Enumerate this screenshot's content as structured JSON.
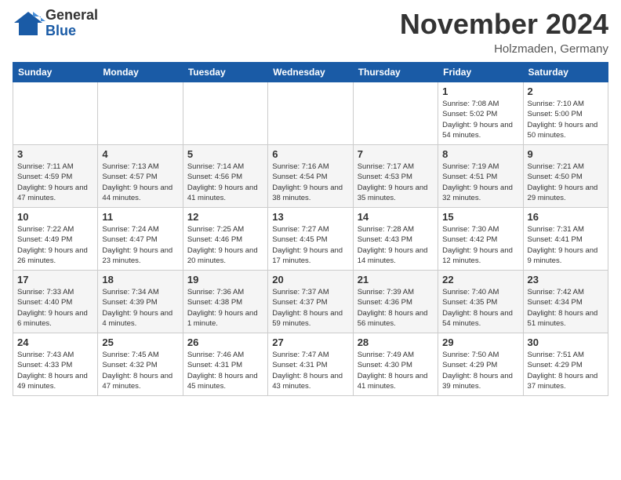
{
  "header": {
    "logo": {
      "general": "General",
      "blue": "Blue"
    },
    "title": "November 2024",
    "location": "Holzmaden, Germany"
  },
  "weekdays": [
    "Sunday",
    "Monday",
    "Tuesday",
    "Wednesday",
    "Thursday",
    "Friday",
    "Saturday"
  ],
  "weeks": [
    [
      {
        "day": "",
        "info": ""
      },
      {
        "day": "",
        "info": ""
      },
      {
        "day": "",
        "info": ""
      },
      {
        "day": "",
        "info": ""
      },
      {
        "day": "",
        "info": ""
      },
      {
        "day": "1",
        "info": "Sunrise: 7:08 AM\nSunset: 5:02 PM\nDaylight: 9 hours and 54 minutes."
      },
      {
        "day": "2",
        "info": "Sunrise: 7:10 AM\nSunset: 5:00 PM\nDaylight: 9 hours and 50 minutes."
      }
    ],
    [
      {
        "day": "3",
        "info": "Sunrise: 7:11 AM\nSunset: 4:59 PM\nDaylight: 9 hours and 47 minutes."
      },
      {
        "day": "4",
        "info": "Sunrise: 7:13 AM\nSunset: 4:57 PM\nDaylight: 9 hours and 44 minutes."
      },
      {
        "day": "5",
        "info": "Sunrise: 7:14 AM\nSunset: 4:56 PM\nDaylight: 9 hours and 41 minutes."
      },
      {
        "day": "6",
        "info": "Sunrise: 7:16 AM\nSunset: 4:54 PM\nDaylight: 9 hours and 38 minutes."
      },
      {
        "day": "7",
        "info": "Sunrise: 7:17 AM\nSunset: 4:53 PM\nDaylight: 9 hours and 35 minutes."
      },
      {
        "day": "8",
        "info": "Sunrise: 7:19 AM\nSunset: 4:51 PM\nDaylight: 9 hours and 32 minutes."
      },
      {
        "day": "9",
        "info": "Sunrise: 7:21 AM\nSunset: 4:50 PM\nDaylight: 9 hours and 29 minutes."
      }
    ],
    [
      {
        "day": "10",
        "info": "Sunrise: 7:22 AM\nSunset: 4:49 PM\nDaylight: 9 hours and 26 minutes."
      },
      {
        "day": "11",
        "info": "Sunrise: 7:24 AM\nSunset: 4:47 PM\nDaylight: 9 hours and 23 minutes."
      },
      {
        "day": "12",
        "info": "Sunrise: 7:25 AM\nSunset: 4:46 PM\nDaylight: 9 hours and 20 minutes."
      },
      {
        "day": "13",
        "info": "Sunrise: 7:27 AM\nSunset: 4:45 PM\nDaylight: 9 hours and 17 minutes."
      },
      {
        "day": "14",
        "info": "Sunrise: 7:28 AM\nSunset: 4:43 PM\nDaylight: 9 hours and 14 minutes."
      },
      {
        "day": "15",
        "info": "Sunrise: 7:30 AM\nSunset: 4:42 PM\nDaylight: 9 hours and 12 minutes."
      },
      {
        "day": "16",
        "info": "Sunrise: 7:31 AM\nSunset: 4:41 PM\nDaylight: 9 hours and 9 minutes."
      }
    ],
    [
      {
        "day": "17",
        "info": "Sunrise: 7:33 AM\nSunset: 4:40 PM\nDaylight: 9 hours and 6 minutes."
      },
      {
        "day": "18",
        "info": "Sunrise: 7:34 AM\nSunset: 4:39 PM\nDaylight: 9 hours and 4 minutes."
      },
      {
        "day": "19",
        "info": "Sunrise: 7:36 AM\nSunset: 4:38 PM\nDaylight: 9 hours and 1 minute."
      },
      {
        "day": "20",
        "info": "Sunrise: 7:37 AM\nSunset: 4:37 PM\nDaylight: 8 hours and 59 minutes."
      },
      {
        "day": "21",
        "info": "Sunrise: 7:39 AM\nSunset: 4:36 PM\nDaylight: 8 hours and 56 minutes."
      },
      {
        "day": "22",
        "info": "Sunrise: 7:40 AM\nSunset: 4:35 PM\nDaylight: 8 hours and 54 minutes."
      },
      {
        "day": "23",
        "info": "Sunrise: 7:42 AM\nSunset: 4:34 PM\nDaylight: 8 hours and 51 minutes."
      }
    ],
    [
      {
        "day": "24",
        "info": "Sunrise: 7:43 AM\nSunset: 4:33 PM\nDaylight: 8 hours and 49 minutes."
      },
      {
        "day": "25",
        "info": "Sunrise: 7:45 AM\nSunset: 4:32 PM\nDaylight: 8 hours and 47 minutes."
      },
      {
        "day": "26",
        "info": "Sunrise: 7:46 AM\nSunset: 4:31 PM\nDaylight: 8 hours and 45 minutes."
      },
      {
        "day": "27",
        "info": "Sunrise: 7:47 AM\nSunset: 4:31 PM\nDaylight: 8 hours and 43 minutes."
      },
      {
        "day": "28",
        "info": "Sunrise: 7:49 AM\nSunset: 4:30 PM\nDaylight: 8 hours and 41 minutes."
      },
      {
        "day": "29",
        "info": "Sunrise: 7:50 AM\nSunset: 4:29 PM\nDaylight: 8 hours and 39 minutes."
      },
      {
        "day": "30",
        "info": "Sunrise: 7:51 AM\nSunset: 4:29 PM\nDaylight: 8 hours and 37 minutes."
      }
    ]
  ]
}
